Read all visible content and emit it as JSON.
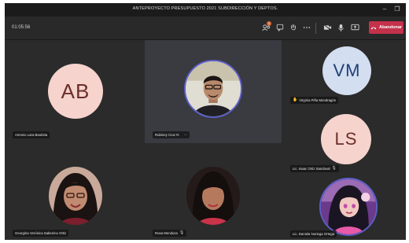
{
  "window": {
    "title": "ANTEPROYECTO PRESUPUESTO 2021 SUBDIRECCIÓN Y DEPTOS.",
    "minimize": "–",
    "restore": "❐"
  },
  "toolbar": {
    "timer": "01:05:56",
    "chat_badge": "1",
    "leave_label": "Abandonar"
  },
  "participants": [
    {
      "name": "Antonio Lara Bautista",
      "initials": "AB",
      "avatar_color": "#f6d3cd"
    },
    {
      "name": "Rubiney Cruz R.",
      "extra": "···"
    },
    {
      "name": "Virginia Piña Mondragón",
      "initials": "VM",
      "avatar_color": "#d3def0",
      "hand_raised": true
    },
    {
      "name": "Lic. Isaac Ortiz Sandoval",
      "initials": "LS",
      "avatar_color": "#f6d3cd",
      "muted": true
    },
    {
      "name": "Georgina Verónica Sabenino Ortiz"
    },
    {
      "name": "Rosa Mendoza",
      "muted": true
    },
    {
      "name": "Lic. Daniela Noriega Ortega"
    }
  ],
  "colors": {
    "accent": "#5b5fc7",
    "leave": "#c4314b"
  }
}
